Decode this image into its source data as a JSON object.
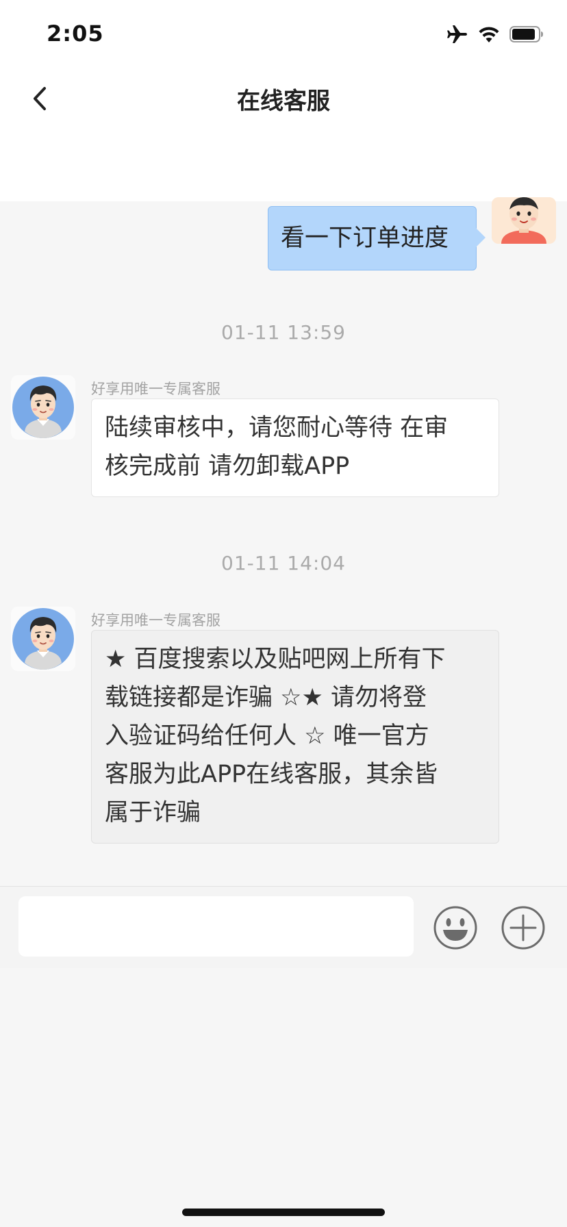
{
  "status_bar": {
    "time": "2:05"
  },
  "header": {
    "title": "在线客服"
  },
  "messages": [
    {
      "type": "user",
      "text": "看一下订单进度"
    },
    {
      "type": "timestamp",
      "text": "01-11 13:59"
    },
    {
      "type": "agent",
      "sender": "好享用唯一专属客服",
      "lines": [
        "陆续审核中，请您耐心等待 在审",
        "核完成前 请勿卸载APP"
      ]
    },
    {
      "type": "timestamp",
      "text": "01-11 14:04"
    },
    {
      "type": "agent",
      "sender": "好享用唯一专属客服",
      "lines": [
        "★ 百度搜索以及贴吧网上所有下",
        "载链接都是诈骗 ☆★ 请勿将登",
        "入验证码给任何人 ☆ 唯一官方",
        "客服为此APP在线客服，其余皆",
        "属于诈骗"
      ]
    }
  ],
  "input_bar": {
    "value": "",
    "placeholder": ""
  },
  "colors": {
    "user_bubble": "#b3d6fb",
    "agent_avatar_bg": "#7aaae8",
    "page_bg": "#f6f6f6"
  },
  "icons": {
    "back": "chevron-left-icon",
    "emoji": "smiley-icon",
    "plus": "plus-circle-icon",
    "airplane": "airplane-icon",
    "wifi": "wifi-icon",
    "battery": "battery-icon"
  }
}
